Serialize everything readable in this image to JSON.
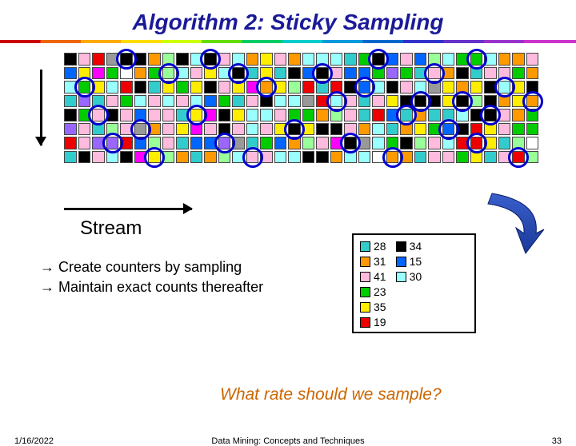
{
  "title": "Algorithm 2: Sticky Sampling",
  "stream_label": "Stream",
  "bullets": {
    "b1": "Create counters by sampling",
    "b2": "Maintain exact counts thereafter"
  },
  "legend": {
    "col1": [
      {
        "color": "teal",
        "count": 28
      },
      {
        "color": "orange",
        "count": 31
      },
      {
        "color": "pink",
        "count": 41
      },
      {
        "color": "green",
        "count": 23
      },
      {
        "color": "yellow",
        "count": 35
      },
      {
        "color": "red",
        "count": 19
      }
    ],
    "col2": [
      {
        "color": "black",
        "count": 34
      },
      {
        "color": "blue",
        "count": 15
      },
      {
        "color": "cyan",
        "count": 30
      }
    ]
  },
  "question": "What rate should we sample?",
  "footer": {
    "date": "1/16/2022",
    "mid": "Data Mining: Concepts and Techniques",
    "page": "33"
  },
  "grid": {
    "rows": 8,
    "cols": 34,
    "palette": [
      "teal",
      "orange",
      "pink",
      "blue",
      "green",
      "yellow",
      "red",
      "black",
      "white",
      "cyan",
      "ltgreen",
      "purple",
      "magenta",
      "gray"
    ]
  },
  "sampled_rings": [
    [
      0,
      4
    ],
    [
      0,
      10
    ],
    [
      0,
      22
    ],
    [
      0,
      29
    ],
    [
      1,
      7
    ],
    [
      1,
      12
    ],
    [
      1,
      18
    ],
    [
      1,
      26
    ],
    [
      2,
      1
    ],
    [
      2,
      14
    ],
    [
      2,
      21
    ],
    [
      2,
      31
    ],
    [
      3,
      19
    ],
    [
      3,
      25
    ],
    [
      3,
      28
    ],
    [
      3,
      33
    ],
    [
      4,
      2
    ],
    [
      4,
      9
    ],
    [
      4,
      24
    ],
    [
      4,
      30
    ],
    [
      5,
      5
    ],
    [
      5,
      16
    ],
    [
      5,
      27
    ],
    [
      6,
      3
    ],
    [
      6,
      11
    ],
    [
      6,
      20
    ],
    [
      6,
      29
    ],
    [
      7,
      6
    ],
    [
      7,
      13
    ],
    [
      7,
      23
    ],
    [
      7,
      32
    ]
  ]
}
